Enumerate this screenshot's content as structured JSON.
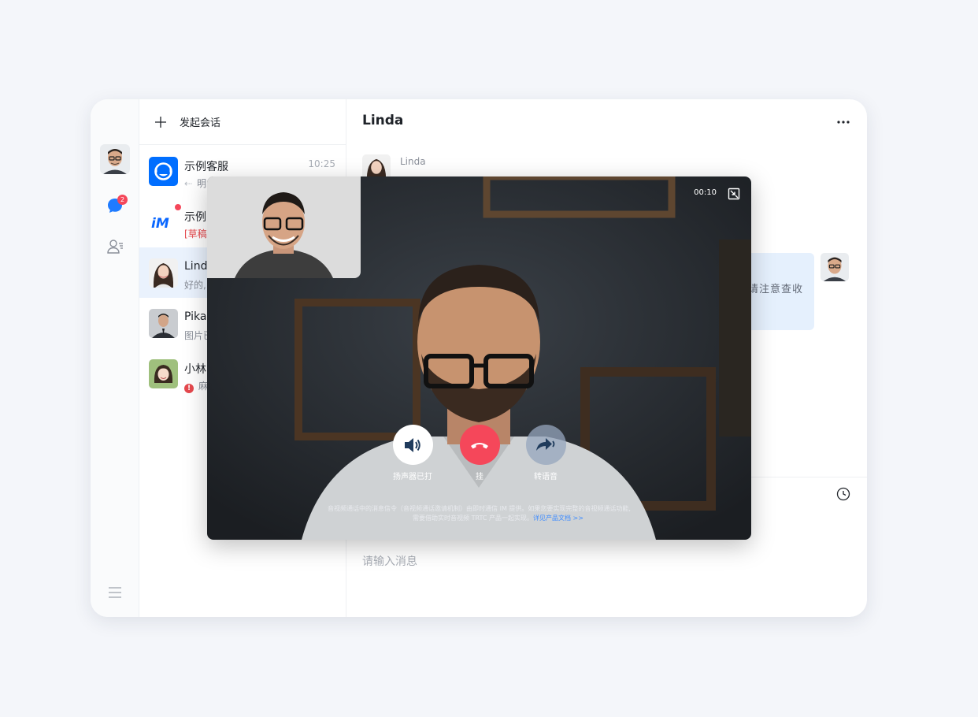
{
  "sidebar": {
    "unread_badge": "2"
  },
  "list": {
    "new_chat_label": "发起会话",
    "conversations": [
      {
        "name": "示例客服",
        "preview": "明",
        "time": "10:25"
      },
      {
        "name": "示例",
        "preview": "[草稿"
      },
      {
        "name": "Lind",
        "preview": "好的,"
      },
      {
        "name": "Pika",
        "preview": "图片已"
      },
      {
        "name": "小林",
        "preview": "麻"
      }
    ]
  },
  "chat": {
    "title": "Linda",
    "sender_name": "Linda",
    "bubble_text_fragment": "请注意查收",
    "input_placeholder": "请输入消息"
  },
  "call": {
    "timer": "00:10",
    "controls": {
      "speaker": "扬声器已打",
      "hangup": "挂",
      "voice": "转语音"
    },
    "notice_line1": "音视频通话中的消息信令（音视频通话邀请机制）由即时通信 IM 提供。如果您要实现完整的音视频通话功能,",
    "notice_line2": "需要借助实时音视频 TRTC 产品一起实现。",
    "notice_link": "详见产品文档 >>"
  },
  "colors": {
    "accent": "#006eff",
    "hangup": "#f5475a",
    "badge": "#f5475a",
    "active_row": "#eaf2fd"
  }
}
